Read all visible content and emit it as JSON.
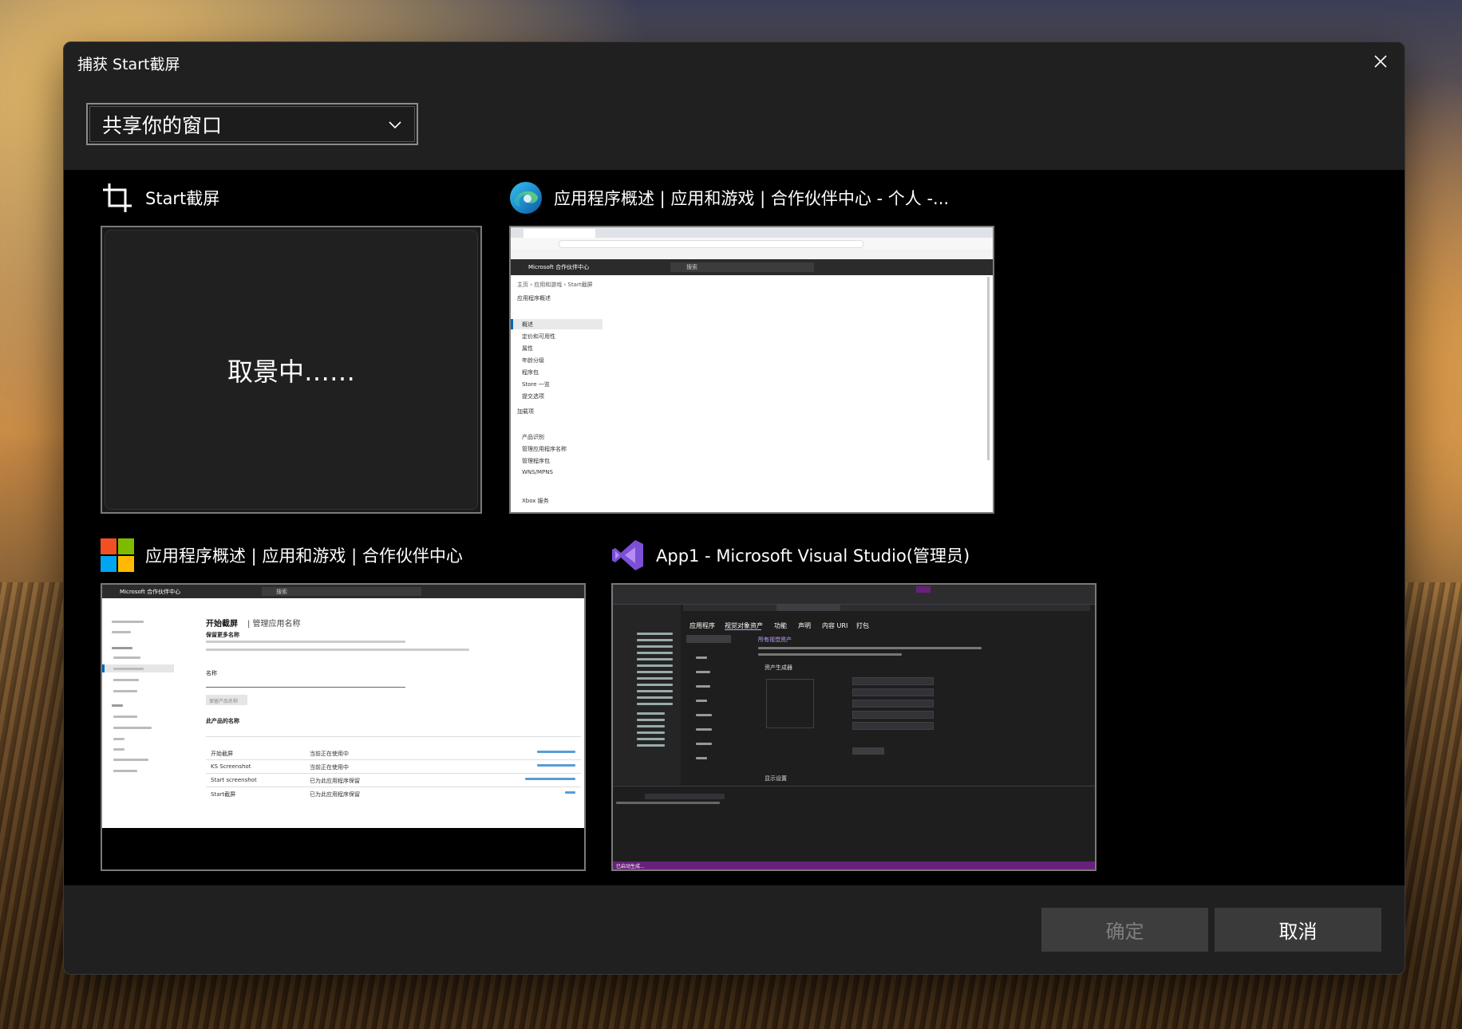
{
  "dialog": {
    "title": "捕获 Start截屏",
    "close_icon": "close-icon",
    "dropdown": {
      "selected": "共享你的窗口"
    }
  },
  "windows": [
    {
      "title": "Start截屏",
      "icon": "crop-icon",
      "thumb_status": "取景中……"
    },
    {
      "title": "应用程序概述 | 应用和游戏 | 合作伙伴中心 - 个人 -...",
      "icon": "edge-icon"
    },
    {
      "title": "应用程序概述 | 应用和游戏 | 合作伙伴中心",
      "icon": "microsoft-logo-icon"
    },
    {
      "title": "App1 - Microsoft Visual Studio(管理员)",
      "icon": "visual-studio-icon"
    }
  ],
  "edge_thumb": {
    "header": "Microsoft 合作伙伴中心",
    "search": "搜索",
    "breadcrumb": "主页 › 应用和游戏 › Start截屏",
    "page_title": "应用程序概述",
    "nav": [
      "概述",
      "定价和可用性",
      "属性",
      "年龄分级",
      "程序包",
      "Store 一览",
      "提交选项",
      "加载项",
      "产品识别",
      "管理应用程序名称",
      "管理程序包",
      "WNS/MPNS",
      "Xbox 服务"
    ]
  },
  "mspc_thumb": {
    "header": "Microsoft 合作伙伴中心",
    "search": "搜索",
    "page_title": "开始截屏",
    "page_subtitle": "| 管理应用名称",
    "section1": "保留更多名称",
    "field_label": "名称",
    "button": "保留产品名称",
    "section2": "此产品的名称",
    "rows": [
      {
        "name": "开始截屏",
        "status": "当前正在使用中"
      },
      {
        "name": "KS Screenshot",
        "status": "当前正在使用中"
      },
      {
        "name": "Start screenshot",
        "status": "已为此应用程序保留"
      },
      {
        "name": "Start截屏",
        "status": "已为此应用程序保留"
      }
    ]
  },
  "vs_thumb": {
    "tabs": [
      "应用程序",
      "视觉对象资产",
      "功能",
      "声明",
      "内容 URI",
      "打包"
    ],
    "section_title": "所有视觉资产",
    "subsection": "资产生成器",
    "bottom_section": "显示设置",
    "status": "已启动生成..."
  },
  "footer": {
    "ok_label": "确定",
    "cancel_label": "取消"
  }
}
